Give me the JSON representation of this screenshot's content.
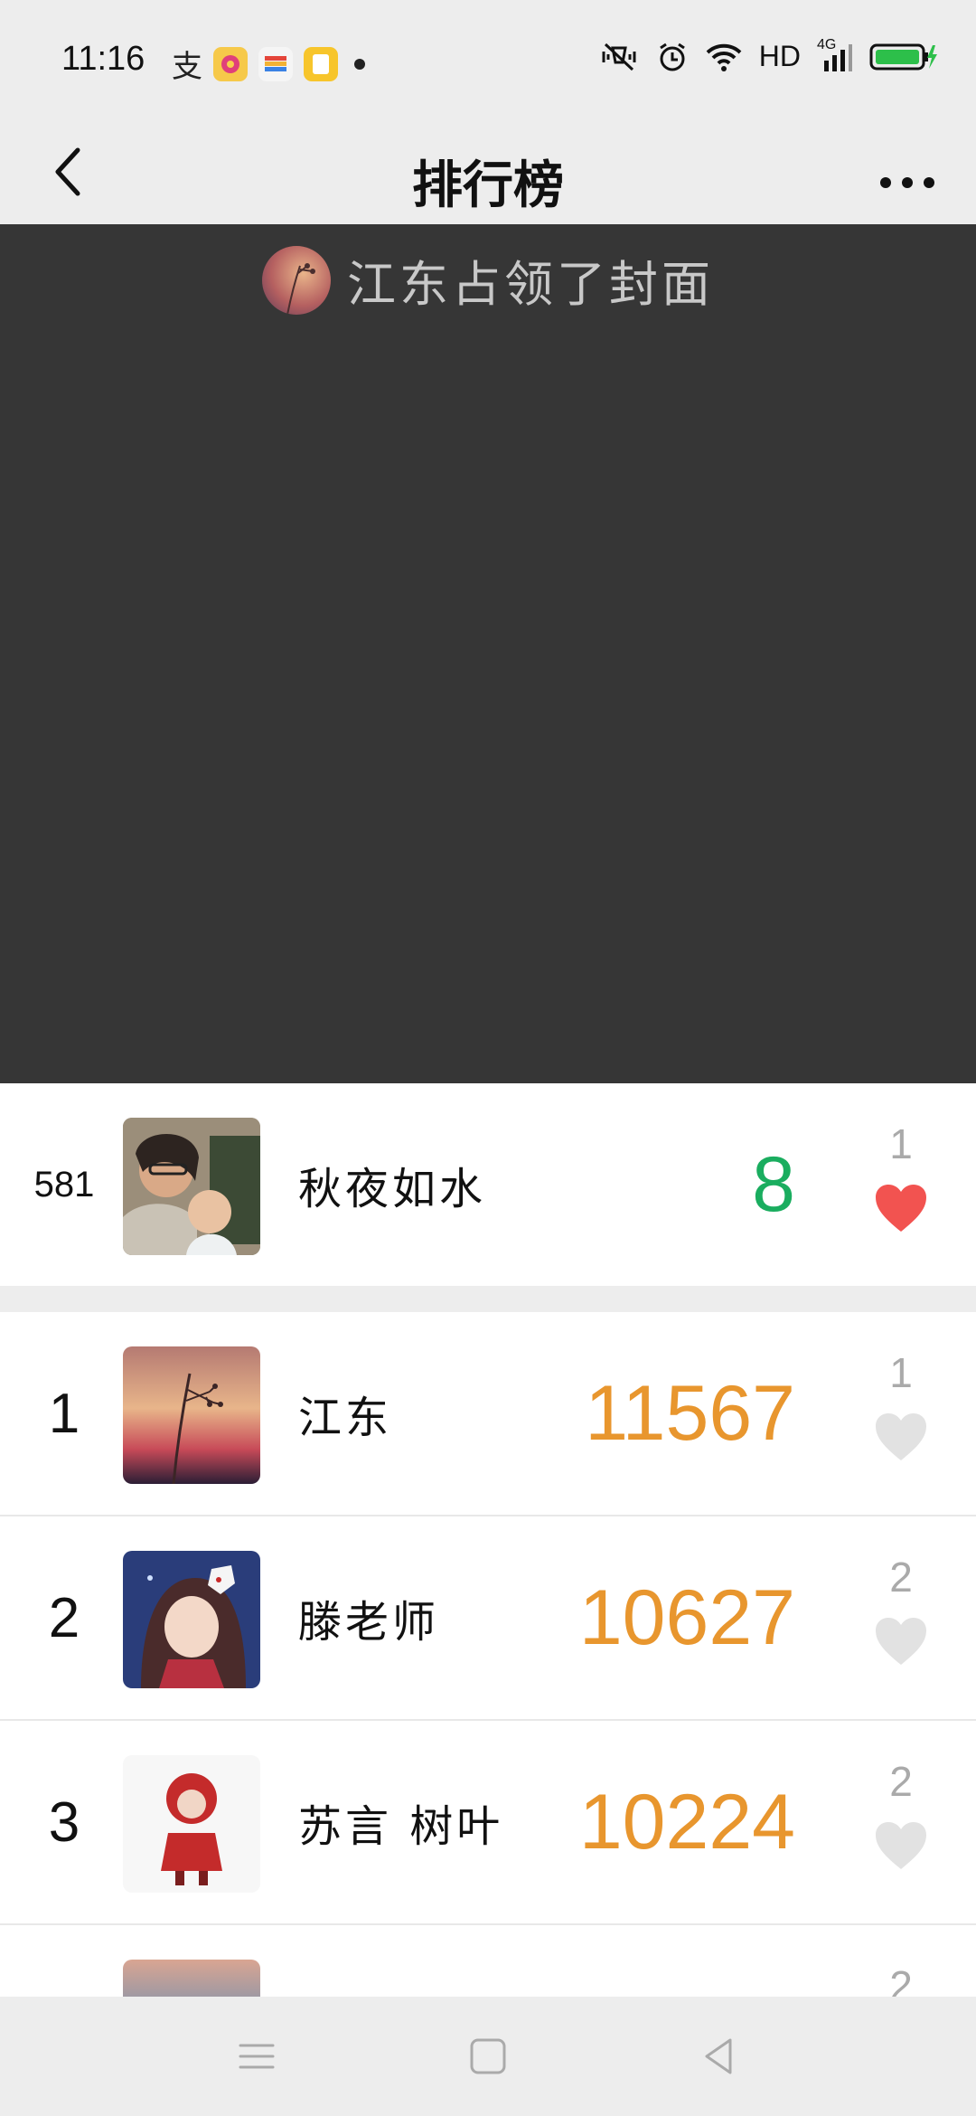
{
  "status_bar": {
    "time": "11:16",
    "network": "HD",
    "signal_label": "4G"
  },
  "nav": {
    "title": "排行榜"
  },
  "cover": {
    "text": "江东占领了封面"
  },
  "me": {
    "rank": "581",
    "name": "秋夜如水",
    "score": "8",
    "likes": "1",
    "liked": true
  },
  "ranking": [
    {
      "rank": "1",
      "name": "江东",
      "score": "11567",
      "likes": "1",
      "liked": false
    },
    {
      "rank": "2",
      "name": "滕老师",
      "score": "10627",
      "likes": "2",
      "liked": false
    },
    {
      "rank": "3",
      "name": "苏言 树叶",
      "score": "10224",
      "likes": "2",
      "liked": false
    },
    {
      "rank": "",
      "name": "",
      "score": "",
      "likes": "2",
      "liked": false
    }
  ],
  "colors": {
    "my_score": "#1aad5f",
    "rank_score": "#e8962e",
    "heart_liked": "#f25350",
    "heart_empty": "#e2e2e2"
  }
}
